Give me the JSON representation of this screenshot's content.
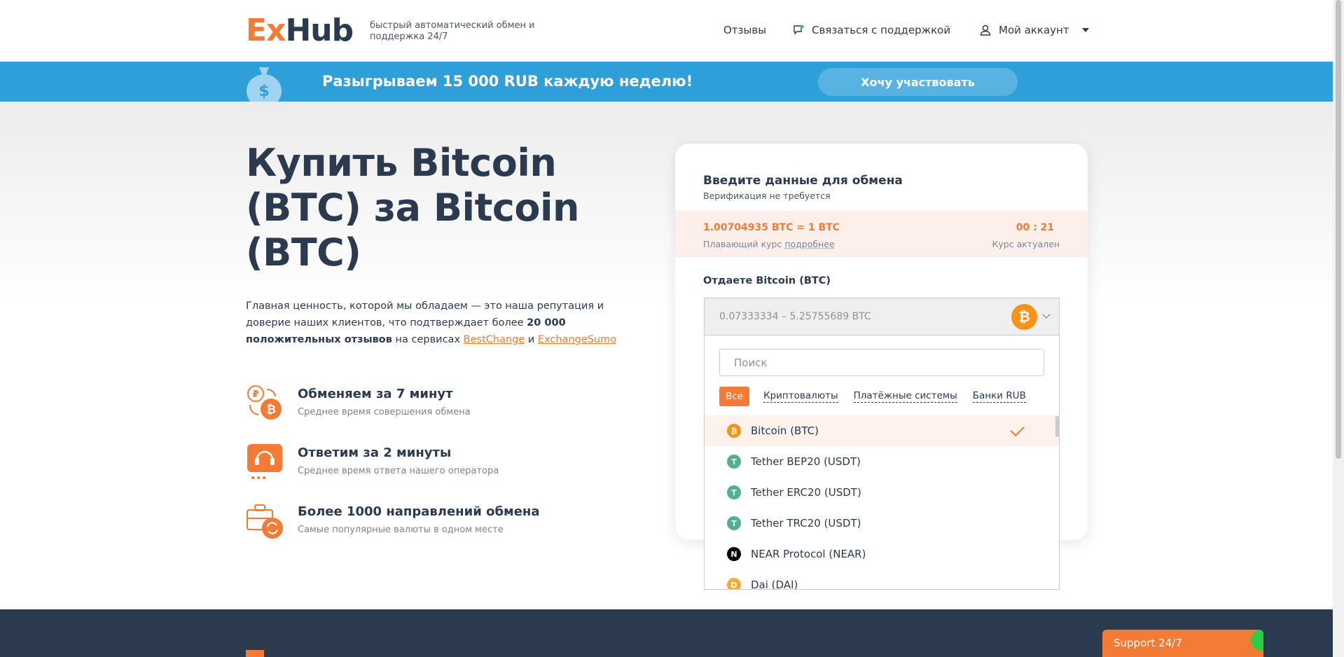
{
  "header": {
    "logo_ex": "Ex",
    "logo_hub": "Hub",
    "tagline": "быстрый автоматический обмен и поддержка 24/7",
    "nav_reviews": "Отзывы",
    "nav_support": "Связаться с поддержкой",
    "nav_account": "Мой аккаунт"
  },
  "banner": {
    "text": "Разыгрываем 15 000 RUB каждую неделю!",
    "button": "Хочу участвовать"
  },
  "hero": {
    "title": "Купить Bitcoin (BTC) за Bitcoin (BTC)",
    "desc_part1": "Главная ценность, которой мы обладаем — это наша репутация и доверие наших клиентов, что подтверждает более ",
    "desc_bold": "20 000 положительных отзывов",
    "desc_part2": " на сервисах ",
    "link1": "BestChange",
    "desc_and": " и ",
    "link2": "ExchangeSumo",
    "features": [
      {
        "title": "Обменяем за 7 минут",
        "sub": "Среднее время совершения обмена"
      },
      {
        "title": "Ответим за 2 минуты",
        "sub": "Среднее время ответа нашего оператора"
      },
      {
        "title": "Более 1000 направлений обмена",
        "sub": "Самые популярные валюты в одном месте"
      }
    ]
  },
  "card": {
    "title": "Введите данные для обмена",
    "subtitle": "Верификация не требуется",
    "rate": "1.00704935 BTC = 1 BTC",
    "rate_note_prefix": "Плавающий курс ",
    "rate_note_link": "подробнее",
    "timer": "00 : 21",
    "timer_note": "Курс актуален",
    "give_label": "Отдаете Bitcoin (BTC)",
    "range": "0.07333334 – 5.25755689 BTC"
  },
  "dropdown": {
    "search_placeholder": "Поиск",
    "filters": [
      "Все",
      "Криптовалюты",
      "Платёжные системы",
      "Банки RUB"
    ],
    "items": [
      {
        "label": "Bitcoin (BTC)",
        "icon": "bitcoin-icon",
        "color": "#f7931a",
        "glyph": "₿",
        "selected": true
      },
      {
        "label": "Tether BEP20 (USDT)",
        "icon": "tether-icon",
        "color": "#50af95",
        "glyph": "T"
      },
      {
        "label": "Tether ERC20 (USDT)",
        "icon": "tether-icon",
        "color": "#50af95",
        "glyph": "T"
      },
      {
        "label": "Tether TRC20 (USDT)",
        "icon": "tether-icon",
        "color": "#50af95",
        "glyph": "T"
      },
      {
        "label": "NEAR Protocol (NEAR)",
        "icon": "near-icon",
        "color": "#000000",
        "glyph": "N"
      },
      {
        "label": "Dai (DAI)",
        "icon": "dai-icon",
        "color": "#f5ac37",
        "glyph": "D"
      }
    ]
  },
  "support_tab": "Support 24/7",
  "colors": {
    "accent": "#f47b35",
    "banner": "#2f9fd9",
    "dark": "#2b3a4f"
  }
}
